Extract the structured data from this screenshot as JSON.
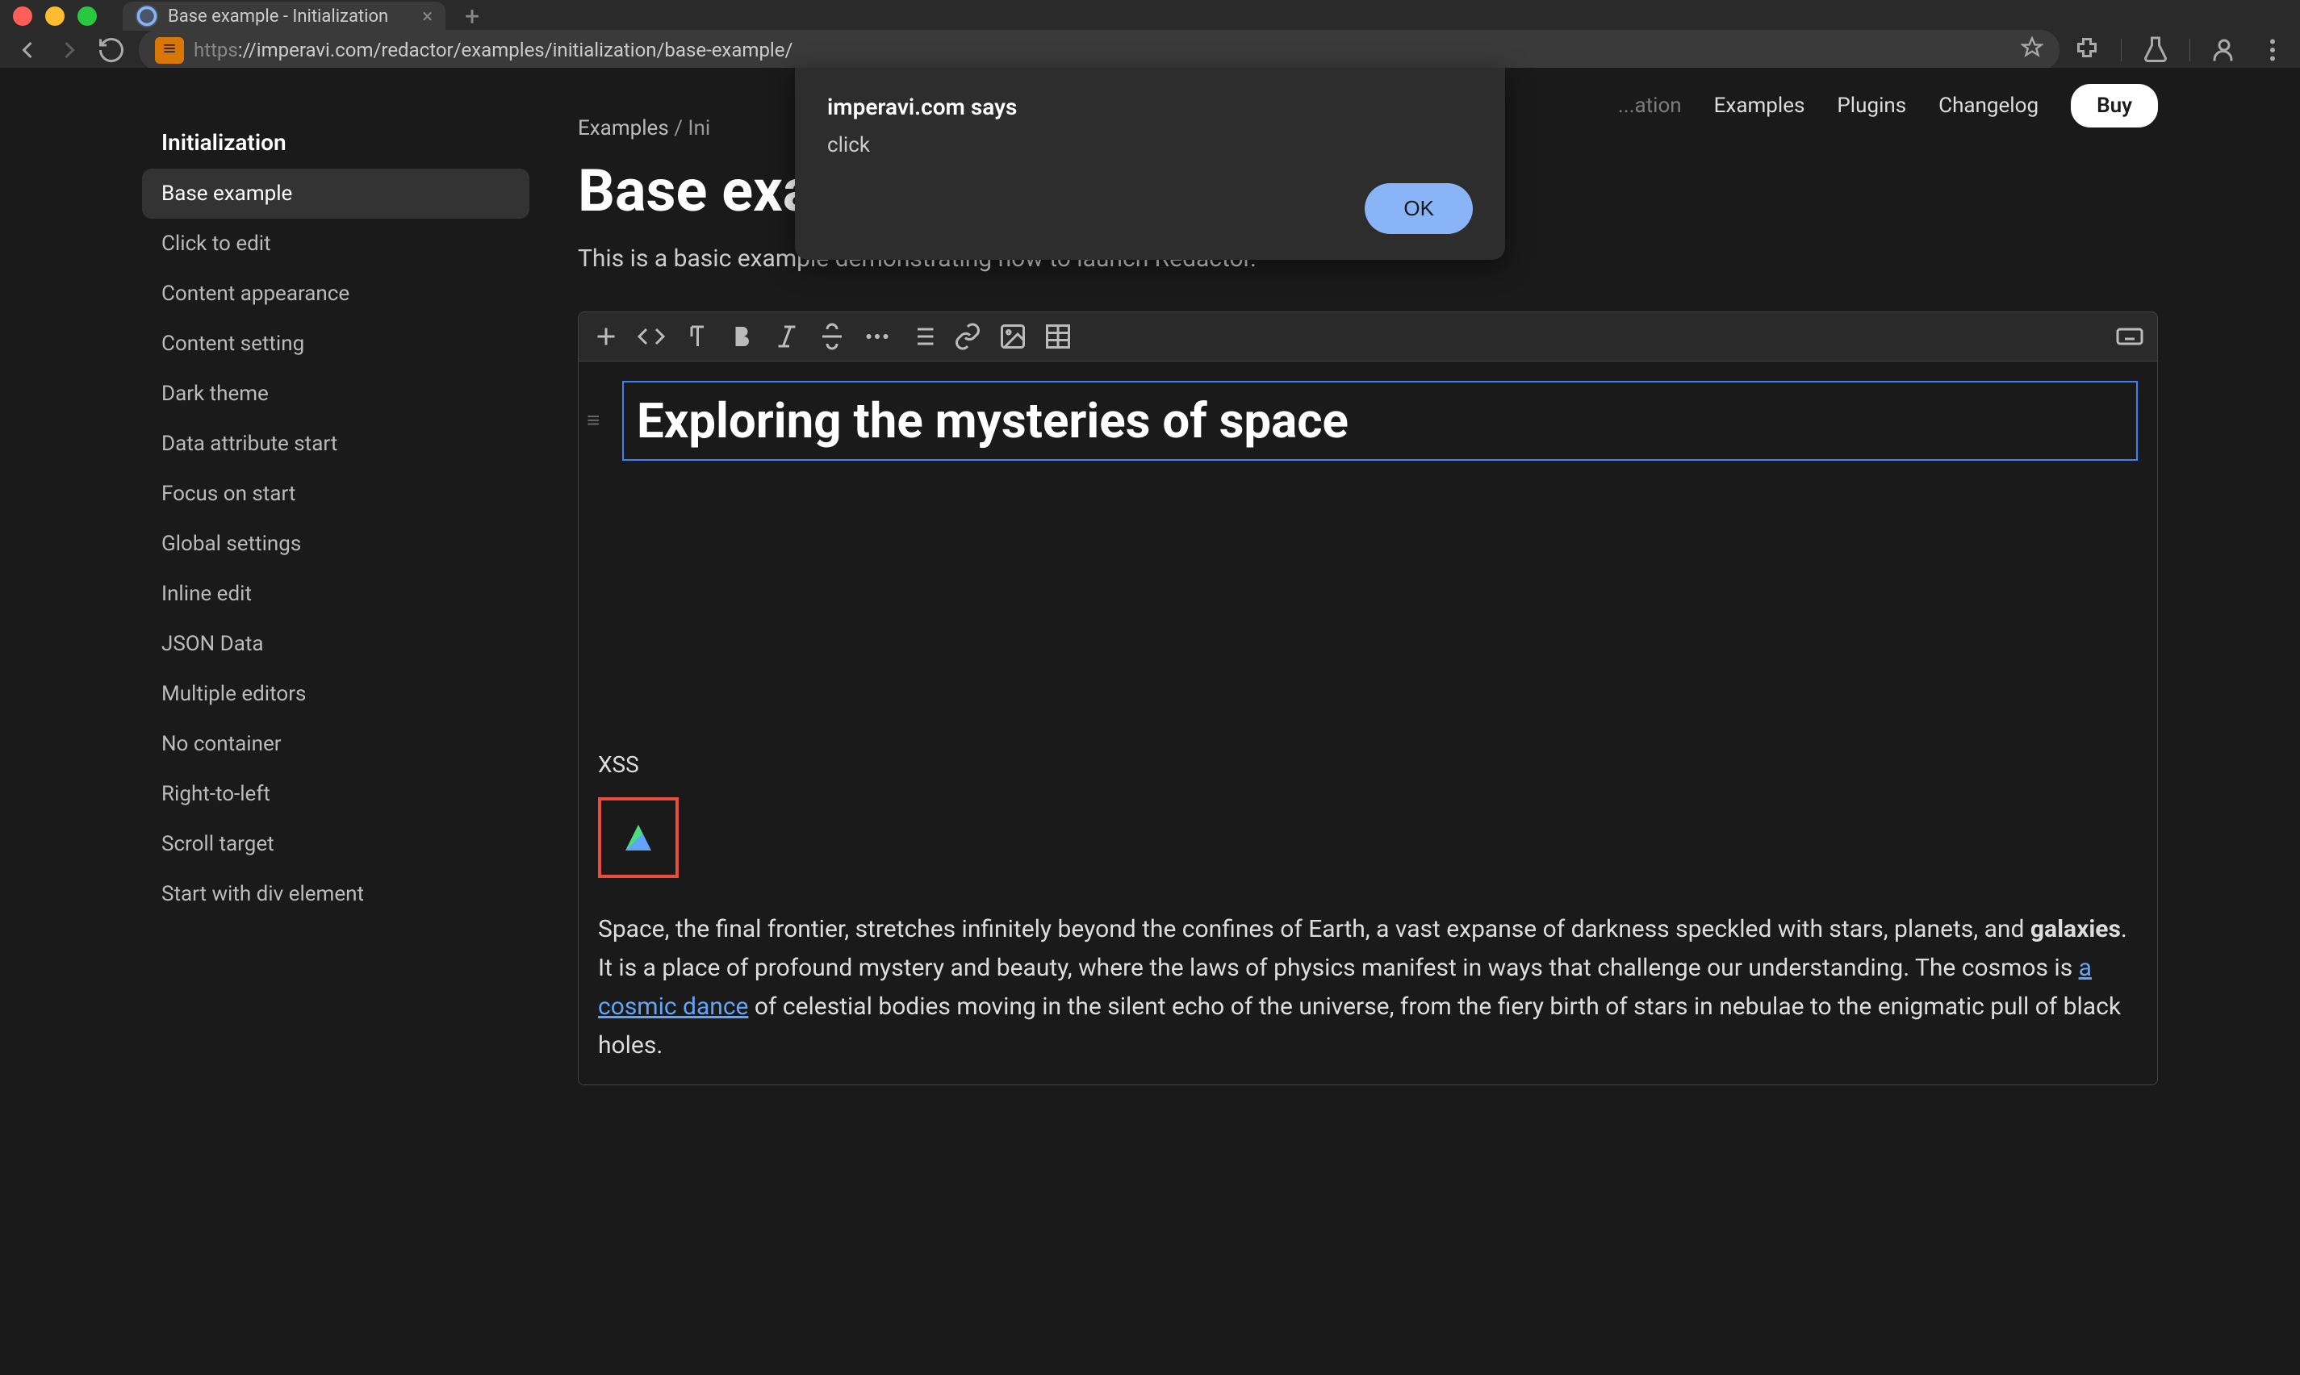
{
  "browser": {
    "tab_title": "Base example - Initialization",
    "url_protocol": "https",
    "url_rest": "://imperavi.com/redactor/examples/initialization/base-example/"
  },
  "dialog": {
    "title": "imperavi.com says",
    "message": "click",
    "ok_label": "OK"
  },
  "topnav": {
    "items": [
      "...ation",
      "Examples",
      "Plugins",
      "Changelog"
    ],
    "buy_label": "Buy"
  },
  "sidebar": {
    "heading": "Initialization",
    "items": [
      {
        "label": "Base example",
        "active": true
      },
      {
        "label": "Click to edit"
      },
      {
        "label": "Content appearance"
      },
      {
        "label": "Content setting"
      },
      {
        "label": "Dark theme"
      },
      {
        "label": "Data attribute start"
      },
      {
        "label": "Focus on start"
      },
      {
        "label": "Global settings"
      },
      {
        "label": "Inline edit"
      },
      {
        "label": "JSON Data"
      },
      {
        "label": "Multiple editors"
      },
      {
        "label": "No container"
      },
      {
        "label": "Right-to-left"
      },
      {
        "label": "Scroll target"
      },
      {
        "label": "Start with div element"
      }
    ]
  },
  "breadcrumb": {
    "part1": "Examples",
    "sep": " / ",
    "part2": "Ini"
  },
  "page_title": "Base example",
  "page_subtitle": "This is a basic example demonstrating how to launch Redactor.",
  "editor": {
    "heading": "Exploring the mysteries of space",
    "xss_label": "XSS",
    "body_pre": "Space, the final frontier, stretches infinitely beyond the confines of Earth, a vast expanse of darkness speckled with stars, planets, and ",
    "body_bold": "galaxies",
    "body_mid": ". It is a place of profound mystery and beauty, where the laws of physics manifest in ways that challenge our understanding. The cosmos is ",
    "body_link": "a cosmic dance",
    "body_post": " of celestial bodies moving in the silent echo of the universe, from the fiery birth of stars in nebulae to the enigmatic pull of black holes."
  }
}
